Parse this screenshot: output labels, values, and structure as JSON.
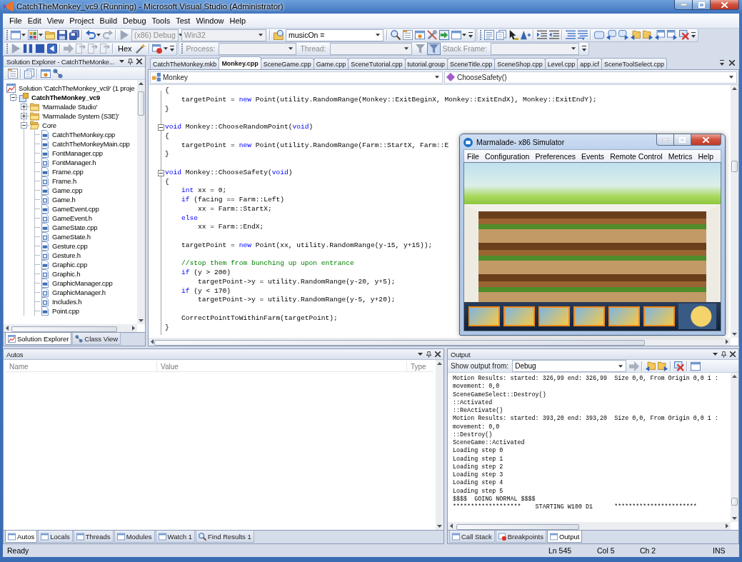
{
  "window": {
    "title": "CatchTheMonkey_vc9 (Running) - Microsoft Visual Studio (Administrator)"
  },
  "menu": [
    "File",
    "Edit",
    "View",
    "Project",
    "Build",
    "Debug",
    "Tools",
    "Test",
    "Window",
    "Help"
  ],
  "standard_toolbar": {
    "configuration": {
      "value": "(x86) Debug",
      "disabled": true
    },
    "platform": {
      "value": "Win32",
      "disabled": true
    },
    "find_text": "musicOn ="
  },
  "debug_toolbar": {
    "hex": {
      "label": "Hex",
      "pressed": false
    }
  },
  "debug_location": {
    "disabled": true,
    "process_label": "Process:",
    "thread_label": "Thread:",
    "filters": [
      {
        "pressed": false
      },
      {
        "pressed": true
      }
    ],
    "stack_frame_label": "Stack Frame:"
  },
  "solution_explorer": {
    "title": "Solution Explorer - CatchTheMonke...",
    "tree": [
      {
        "label": "Solution 'CatchTheMonkey_vc9' (1 proje",
        "kind": "solution",
        "children": [
          {
            "label": "CatchTheMonkey_vc9",
            "kind": "project",
            "expanded": true,
            "children": [
              {
                "label": "'Marmalade Studio'",
                "kind": "folder",
                "expanded": false
              },
              {
                "label": "'Marmalade System (S3E)'",
                "kind": "folder",
                "expanded": false
              },
              {
                "label": "Core",
                "kind": "folder",
                "expanded": true,
                "children": [
                  {
                    "label": "CatchTheMonkey.cpp",
                    "kind": "cpp"
                  },
                  {
                    "label": "CatchTheMonkeyMain.cpp",
                    "kind": "cpp"
                  },
                  {
                    "label": "FontManager.cpp",
                    "kind": "cpp"
                  },
                  {
                    "label": "FontManager.h",
                    "kind": "h"
                  },
                  {
                    "label": "Frame.cpp",
                    "kind": "cpp"
                  },
                  {
                    "label": "Frame.h",
                    "kind": "h"
                  },
                  {
                    "label": "Game.cpp",
                    "kind": "cpp"
                  },
                  {
                    "label": "Game.h",
                    "kind": "h"
                  },
                  {
                    "label": "GameEvent.cpp",
                    "kind": "cpp"
                  },
                  {
                    "label": "GameEvent.h",
                    "kind": "h"
                  },
                  {
                    "label": "GameState.cpp",
                    "kind": "cpp"
                  },
                  {
                    "label": "GameState.h",
                    "kind": "h"
                  },
                  {
                    "label": "Gesture.cpp",
                    "kind": "cpp"
                  },
                  {
                    "label": "Gesture.h",
                    "kind": "h"
                  },
                  {
                    "label": "Graphic.cpp",
                    "kind": "cpp"
                  },
                  {
                    "label": "Graphic.h",
                    "kind": "h"
                  },
                  {
                    "label": "GraphicManager.cpp",
                    "kind": "cpp"
                  },
                  {
                    "label": "GraphicManager.h",
                    "kind": "h"
                  },
                  {
                    "label": "Includes.h",
                    "kind": "h"
                  },
                  {
                    "label": "Point.cpp",
                    "kind": "cpp"
                  }
                ]
              }
            ]
          }
        ]
      }
    ],
    "tabs": [
      {
        "label": "Solution Explorer",
        "selected": true
      },
      {
        "label": "Class View",
        "selected": false
      }
    ]
  },
  "editor": {
    "tabs": [
      {
        "label": "CatchTheMonkey.mkb",
        "selected": false
      },
      {
        "label": "Monkey.cpp",
        "selected": true
      },
      {
        "label": "SceneGame.cpp",
        "selected": false
      },
      {
        "label": "Game.cpp",
        "selected": false
      },
      {
        "label": "SceneTutorial.cpp",
        "selected": false
      },
      {
        "label": "tutorial.group",
        "selected": false
      },
      {
        "label": "SceneTitle.cpp",
        "selected": false
      },
      {
        "label": "SceneShop.cpp",
        "selected": false
      },
      {
        "label": "Level.cpp",
        "selected": false
      },
      {
        "label": "app.icf",
        "selected": false
      },
      {
        "label": "SceneToolSelect.cpp",
        "selected": false
      }
    ],
    "type_scope": "Monkey",
    "member_scope": "ChooseSafety()",
    "lines": [
      {
        "collapsible": false,
        "segments": [
          {
            "text": "{",
            "kind": "plain"
          }
        ]
      },
      {
        "collapsible": false,
        "segments": [
          {
            "text": "    targetPoint = ",
            "kind": "plain"
          },
          {
            "text": "new",
            "kind": "keyword"
          },
          {
            "text": " Point(utility.RandomRange(Monkey::ExitBeginX, Monkey::ExitEndX), Monkey::ExitEndY);",
            "kind": "plain"
          }
        ]
      },
      {
        "collapsible": false,
        "segments": [
          {
            "text": "}",
            "kind": "plain"
          }
        ]
      },
      {
        "collapsible": false
      },
      {
        "collapsible": true,
        "segments": [
          {
            "text": "void",
            "kind": "keyword"
          },
          {
            "text": " Monkey::ChooseRandomPoint(",
            "kind": "plain"
          },
          {
            "text": "void",
            "kind": "keyword"
          },
          {
            "text": ")",
            "kind": "plain"
          }
        ]
      },
      {
        "collapsible": false,
        "segments": [
          {
            "text": "{",
            "kind": "plain"
          }
        ]
      },
      {
        "collapsible": false,
        "segments": [
          {
            "text": "    targetPoint = ",
            "kind": "plain"
          },
          {
            "text": "new",
            "kind": "keyword"
          },
          {
            "text": " Point(utility.RandomRange(Farm::StartX, Farm::E",
            "kind": "plain"
          }
        ]
      },
      {
        "collapsible": false,
        "segments": [
          {
            "text": "}",
            "kind": "plain"
          }
        ]
      },
      {
        "collapsible": false
      },
      {
        "collapsible": true,
        "segments": [
          {
            "text": "void",
            "kind": "keyword"
          },
          {
            "text": " Monkey::ChooseSafety(",
            "kind": "plain"
          },
          {
            "text": "void",
            "kind": "keyword"
          },
          {
            "text": ")",
            "kind": "plain"
          }
        ]
      },
      {
        "collapsible": false,
        "segments": [
          {
            "text": "{",
            "kind": "plain"
          }
        ]
      },
      {
        "collapsible": false,
        "segments": [
          {
            "text": "    int",
            "kind": "keyword"
          },
          {
            "text": " xx = 0;",
            "kind": "plain"
          }
        ]
      },
      {
        "collapsible": false,
        "segments": [
          {
            "text": "    if",
            "kind": "keyword"
          },
          {
            "text": " (facing == Farm::Left)",
            "kind": "plain"
          }
        ]
      },
      {
        "collapsible": false,
        "segments": [
          {
            "text": "        xx = Farm::StartX;",
            "kind": "plain"
          }
        ]
      },
      {
        "collapsible": false,
        "segments": [
          {
            "text": "    else",
            "kind": "keyword"
          }
        ]
      },
      {
        "collapsible": false,
        "segments": [
          {
            "text": "        xx = Farm::EndX;",
            "kind": "plain"
          }
        ]
      },
      {
        "collapsible": false
      },
      {
        "collapsible": false,
        "segments": [
          {
            "text": "    targetPoint = ",
            "kind": "plain"
          },
          {
            "text": "new",
            "kind": "keyword"
          },
          {
            "text": " Point(xx, utility.RandomRange(y-15, y+15));",
            "kind": "plain"
          }
        ]
      },
      {
        "collapsible": false
      },
      {
        "collapsible": false,
        "segments": [
          {
            "text": "    //stop them from bunching up upon entrance",
            "kind": "comment"
          }
        ]
      },
      {
        "collapsible": false,
        "segments": [
          {
            "text": "    if",
            "kind": "keyword"
          },
          {
            "text": " (y > 200)",
            "kind": "plain"
          }
        ]
      },
      {
        "collapsible": false,
        "segments": [
          {
            "text": "        targetPoint->y = utility.RandomRange(y-20, y+5);",
            "kind": "plain"
          }
        ]
      },
      {
        "collapsible": false,
        "segments": [
          {
            "text": "    if",
            "kind": "keyword"
          },
          {
            "text": " (y < 170)",
            "kind": "plain"
          }
        ]
      },
      {
        "collapsible": false,
        "segments": [
          {
            "text": "        targetPoint->y = utility.RandomRange(y-5, y+20);",
            "kind": "plain"
          }
        ]
      },
      {
        "collapsible": false
      },
      {
        "collapsible": false,
        "segments": [
          {
            "text": "    CorrectPointToWithinFarm(targetPoint);",
            "kind": "plain"
          }
        ]
      },
      {
        "collapsible": false,
        "segments": [
          {
            "text": "}",
            "kind": "plain"
          }
        ]
      }
    ]
  },
  "simulator": {
    "title": "Marmalade- x86 Simulator",
    "menu": [
      "File",
      "Configuration",
      "Preferences",
      "Events",
      "Remote Control",
      "Metrics",
      "Help"
    ]
  },
  "autos": {
    "title": "Autos",
    "columns": [
      "Name",
      "Value",
      "Type"
    ],
    "tabs": [
      {
        "label": "Autos",
        "selected": true
      },
      {
        "label": "Locals",
        "selected": false
      },
      {
        "label": "Threads",
        "selected": false
      },
      {
        "label": "Modules",
        "selected": false
      },
      {
        "label": "Watch 1",
        "selected": false
      },
      {
        "label": "Find Results 1",
        "selected": false
      }
    ]
  },
  "output": {
    "title": "Output",
    "source_label": "Show output from:",
    "source": "Debug",
    "lines": [
      "Motion Results: started: 326,99 end: 326,99  Size 0,0, From Origin 0,0 1 :",
      "movement: 0,0",
      "SceneGameSelect::Destroy()",
      "::Activated",
      "::ReActivate()",
      "Motion Results: started: 393,20 end: 393,20  Size 0,0, From Origin 0,0 1 :",
      "movement: 0,0",
      "::Destroy()",
      "SceneGame::Activated",
      "Loading step 0",
      "Loading step 1",
      "Loading step 2",
      "Loading step 3",
      "Loading step 4",
      "Loading step 5",
      "$$$$  GOING NORMAL $$$$",
      "*******************    STARTING W100 D1      ***********************"
    ],
    "tabs": [
      {
        "label": "Call Stack",
        "selected": false
      },
      {
        "label": "Breakpoints",
        "selected": false
      },
      {
        "label": "Output",
        "selected": true
      }
    ]
  },
  "status_bar": {
    "message": "Ready",
    "line": "Ln 545",
    "column": "Col 5",
    "char": "Ch 2",
    "mode": "INS"
  }
}
